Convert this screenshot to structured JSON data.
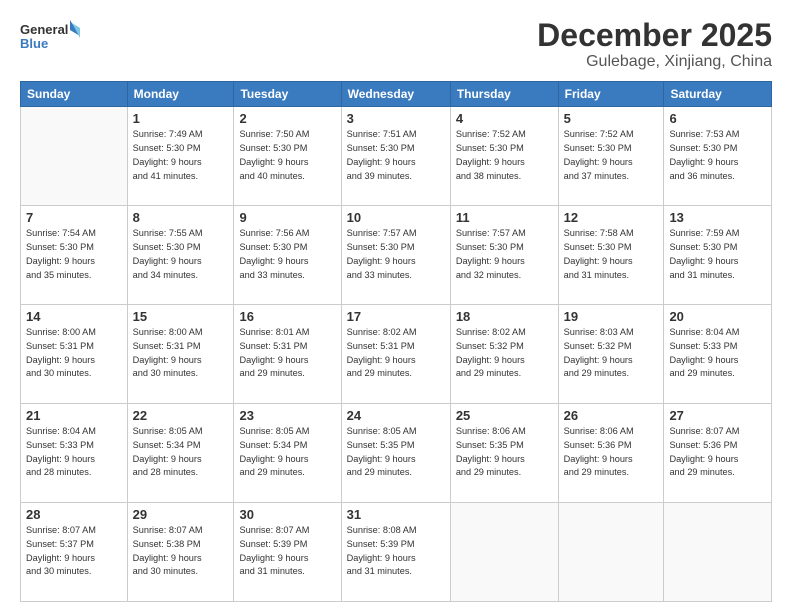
{
  "logo": {
    "general": "General",
    "blue": "Blue"
  },
  "header": {
    "month": "December 2025",
    "location": "Gulebage, Xinjiang, China"
  },
  "weekdays": [
    "Sunday",
    "Monday",
    "Tuesday",
    "Wednesday",
    "Thursday",
    "Friday",
    "Saturday"
  ],
  "weeks": [
    [
      {
        "day": "",
        "info": ""
      },
      {
        "day": "1",
        "info": "Sunrise: 7:49 AM\nSunset: 5:30 PM\nDaylight: 9 hours\nand 41 minutes."
      },
      {
        "day": "2",
        "info": "Sunrise: 7:50 AM\nSunset: 5:30 PM\nDaylight: 9 hours\nand 40 minutes."
      },
      {
        "day": "3",
        "info": "Sunrise: 7:51 AM\nSunset: 5:30 PM\nDaylight: 9 hours\nand 39 minutes."
      },
      {
        "day": "4",
        "info": "Sunrise: 7:52 AM\nSunset: 5:30 PM\nDaylight: 9 hours\nand 38 minutes."
      },
      {
        "day": "5",
        "info": "Sunrise: 7:52 AM\nSunset: 5:30 PM\nDaylight: 9 hours\nand 37 minutes."
      },
      {
        "day": "6",
        "info": "Sunrise: 7:53 AM\nSunset: 5:30 PM\nDaylight: 9 hours\nand 36 minutes."
      }
    ],
    [
      {
        "day": "7",
        "info": "Sunrise: 7:54 AM\nSunset: 5:30 PM\nDaylight: 9 hours\nand 35 minutes."
      },
      {
        "day": "8",
        "info": "Sunrise: 7:55 AM\nSunset: 5:30 PM\nDaylight: 9 hours\nand 34 minutes."
      },
      {
        "day": "9",
        "info": "Sunrise: 7:56 AM\nSunset: 5:30 PM\nDaylight: 9 hours\nand 33 minutes."
      },
      {
        "day": "10",
        "info": "Sunrise: 7:57 AM\nSunset: 5:30 PM\nDaylight: 9 hours\nand 33 minutes."
      },
      {
        "day": "11",
        "info": "Sunrise: 7:57 AM\nSunset: 5:30 PM\nDaylight: 9 hours\nand 32 minutes."
      },
      {
        "day": "12",
        "info": "Sunrise: 7:58 AM\nSunset: 5:30 PM\nDaylight: 9 hours\nand 31 minutes."
      },
      {
        "day": "13",
        "info": "Sunrise: 7:59 AM\nSunset: 5:30 PM\nDaylight: 9 hours\nand 31 minutes."
      }
    ],
    [
      {
        "day": "14",
        "info": "Sunrise: 8:00 AM\nSunset: 5:31 PM\nDaylight: 9 hours\nand 30 minutes."
      },
      {
        "day": "15",
        "info": "Sunrise: 8:00 AM\nSunset: 5:31 PM\nDaylight: 9 hours\nand 30 minutes."
      },
      {
        "day": "16",
        "info": "Sunrise: 8:01 AM\nSunset: 5:31 PM\nDaylight: 9 hours\nand 29 minutes."
      },
      {
        "day": "17",
        "info": "Sunrise: 8:02 AM\nSunset: 5:31 PM\nDaylight: 9 hours\nand 29 minutes."
      },
      {
        "day": "18",
        "info": "Sunrise: 8:02 AM\nSunset: 5:32 PM\nDaylight: 9 hours\nand 29 minutes."
      },
      {
        "day": "19",
        "info": "Sunrise: 8:03 AM\nSunset: 5:32 PM\nDaylight: 9 hours\nand 29 minutes."
      },
      {
        "day": "20",
        "info": "Sunrise: 8:04 AM\nSunset: 5:33 PM\nDaylight: 9 hours\nand 29 minutes."
      }
    ],
    [
      {
        "day": "21",
        "info": "Sunrise: 8:04 AM\nSunset: 5:33 PM\nDaylight: 9 hours\nand 28 minutes."
      },
      {
        "day": "22",
        "info": "Sunrise: 8:05 AM\nSunset: 5:34 PM\nDaylight: 9 hours\nand 28 minutes."
      },
      {
        "day": "23",
        "info": "Sunrise: 8:05 AM\nSunset: 5:34 PM\nDaylight: 9 hours\nand 29 minutes."
      },
      {
        "day": "24",
        "info": "Sunrise: 8:05 AM\nSunset: 5:35 PM\nDaylight: 9 hours\nand 29 minutes."
      },
      {
        "day": "25",
        "info": "Sunrise: 8:06 AM\nSunset: 5:35 PM\nDaylight: 9 hours\nand 29 minutes."
      },
      {
        "day": "26",
        "info": "Sunrise: 8:06 AM\nSunset: 5:36 PM\nDaylight: 9 hours\nand 29 minutes."
      },
      {
        "day": "27",
        "info": "Sunrise: 8:07 AM\nSunset: 5:36 PM\nDaylight: 9 hours\nand 29 minutes."
      }
    ],
    [
      {
        "day": "28",
        "info": "Sunrise: 8:07 AM\nSunset: 5:37 PM\nDaylight: 9 hours\nand 30 minutes."
      },
      {
        "day": "29",
        "info": "Sunrise: 8:07 AM\nSunset: 5:38 PM\nDaylight: 9 hours\nand 30 minutes."
      },
      {
        "day": "30",
        "info": "Sunrise: 8:07 AM\nSunset: 5:39 PM\nDaylight: 9 hours\nand 31 minutes."
      },
      {
        "day": "31",
        "info": "Sunrise: 8:08 AM\nSunset: 5:39 PM\nDaylight: 9 hours\nand 31 minutes."
      },
      {
        "day": "",
        "info": ""
      },
      {
        "day": "",
        "info": ""
      },
      {
        "day": "",
        "info": ""
      }
    ]
  ]
}
